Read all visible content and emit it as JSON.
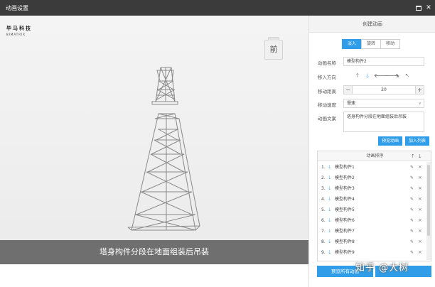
{
  "window": {
    "title": "动画设置"
  },
  "viewport": {
    "logo_cn": "毕马科技",
    "logo_en": "BIMATRIX",
    "view_cube_label": "前",
    "caption": "塔身构件分段在地面组装后吊装"
  },
  "panel": {
    "header": "创建动画",
    "tabs": [
      "淡入",
      "旋转",
      "移动"
    ],
    "active_tab": "淡入",
    "fields": {
      "name_label": "动画名称",
      "name_value": "模型构件2",
      "direction_label": "移入方向",
      "directions": [
        "up-arrow-icon",
        "down-arrow-icon",
        "left-arrow-icon",
        "right-arrow-icon",
        "down-right-arrow-icon",
        "up-left-arrow-icon"
      ],
      "distance_label": "移动距离",
      "distance_value": "20",
      "speed_label": "移动速度",
      "speed_value": "慢速",
      "text_label": "动画文案",
      "text_value": "塔身构件分段在地面组装后吊装"
    },
    "buttons": {
      "preview": "预览动画",
      "add": "加入列表",
      "preview_all": "预览所有动画"
    },
    "order": {
      "title": "动画排序",
      "items": [
        {
          "index": "1.",
          "name": "模型构件1"
        },
        {
          "index": "2.",
          "name": "模型构件2"
        },
        {
          "index": "3.",
          "name": "模型构件3"
        },
        {
          "index": "4.",
          "name": "模型构件4"
        },
        {
          "index": "5.",
          "name": "模型构件5"
        },
        {
          "index": "6.",
          "name": "模型构件6"
        },
        {
          "index": "7.",
          "name": "模型构件7"
        },
        {
          "index": "8.",
          "name": "模型构件8"
        },
        {
          "index": "9.",
          "name": "模型构件9"
        }
      ]
    }
  },
  "watermark": "知乎 @大树",
  "colors": {
    "accent": "#2f9de8",
    "titlebar": "#3b3b3b",
    "caption_bg": "#6f6f6f"
  }
}
